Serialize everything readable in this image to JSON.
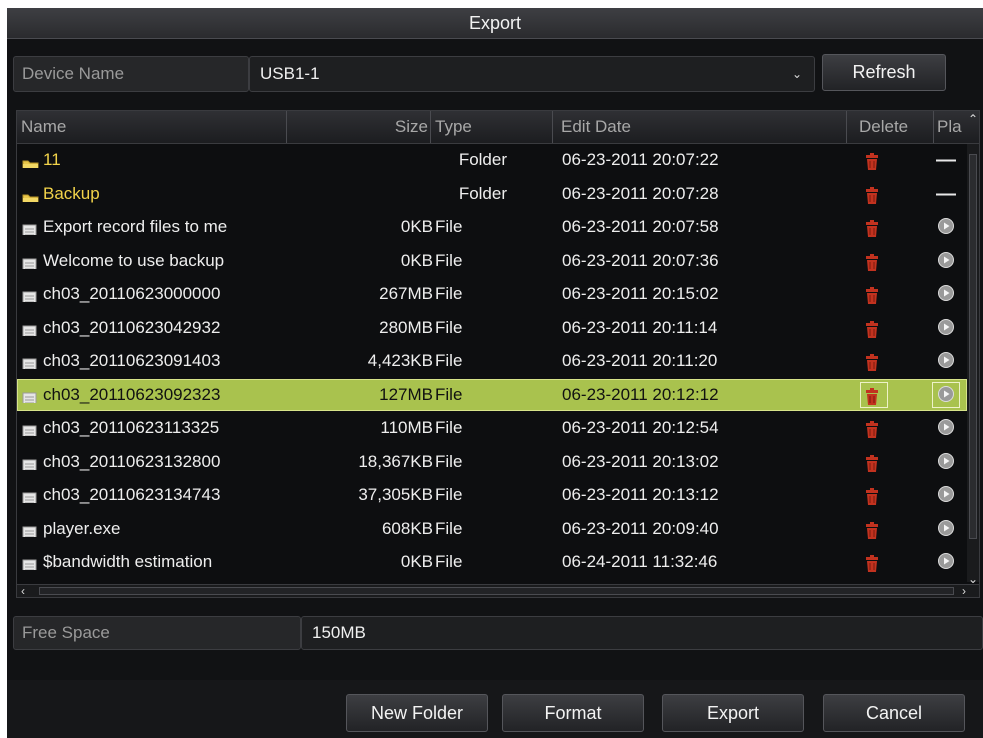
{
  "window": {
    "title": "Export"
  },
  "device": {
    "label": "Device Name",
    "value": "USB1-1",
    "refresh_label": "Refresh"
  },
  "table": {
    "headers": {
      "name": "Name",
      "size": "Size",
      "type": "Type",
      "date": "Edit Date",
      "delete": "Delete",
      "play": "Pla"
    },
    "rows": [
      {
        "name": "11",
        "size": "",
        "type": "Folder",
        "date": "06-23-2011 20:07:22",
        "kind": "folder",
        "play": "—"
      },
      {
        "name": "Backup",
        "size": "",
        "type": "Folder",
        "date": "06-23-2011 20:07:28",
        "kind": "folder",
        "play": "—"
      },
      {
        "name": "Export record files to me",
        "size": "0KB",
        "type": "File",
        "date": "06-23-2011 20:07:58",
        "kind": "file",
        "play": "▶"
      },
      {
        "name": "Welcome to use backup",
        "size": "0KB",
        "type": "File",
        "date": "06-23-2011 20:07:36",
        "kind": "file",
        "play": "▶"
      },
      {
        "name": "ch03_20110623000000",
        "size": "267MB",
        "type": "File",
        "date": "06-23-2011 20:15:02",
        "kind": "file",
        "play": "▶"
      },
      {
        "name": "ch03_20110623042932",
        "size": "280MB",
        "type": "File",
        "date": "06-23-2011 20:11:14",
        "kind": "file",
        "play": "▶"
      },
      {
        "name": "ch03_20110623091403",
        "size": "4,423KB",
        "type": "File",
        "date": "06-23-2011 20:11:20",
        "kind": "file",
        "play": "▶"
      },
      {
        "name": "ch03_20110623092323",
        "size": "127MB",
        "type": "File",
        "date": "06-23-2011 20:12:12",
        "kind": "file",
        "play": "▶",
        "selected": true
      },
      {
        "name": "ch03_20110623113325",
        "size": "110MB",
        "type": "File",
        "date": "06-23-2011 20:12:54",
        "kind": "file",
        "play": "▶"
      },
      {
        "name": "ch03_20110623132800",
        "size": "18,367KB",
        "type": "File",
        "date": "06-23-2011 20:13:02",
        "kind": "file",
        "play": "▶"
      },
      {
        "name": "ch03_20110623134743",
        "size": "37,305KB",
        "type": "File",
        "date": "06-23-2011 20:13:12",
        "kind": "file",
        "play": "▶"
      },
      {
        "name": "player.exe",
        "size": "608KB",
        "type": "File",
        "date": "06-23-2011 20:09:40",
        "kind": "file",
        "play": "▶"
      },
      {
        "name": "$bandwidth estimation",
        "size": "0KB",
        "type": "File",
        "date": "06-24-2011 11:32:46",
        "kind": "file",
        "play": "▶"
      }
    ]
  },
  "free_space": {
    "label": "Free Space",
    "value": "150MB"
  },
  "buttons": {
    "new_folder": "New Folder",
    "format": "Format",
    "export": "Export",
    "cancel": "Cancel"
  },
  "icons": {
    "folder": "folder-icon",
    "file": "file-icon",
    "delete": "trash-icon",
    "play": "play-icon",
    "dropdown": "chevron-down-icon"
  },
  "colors": {
    "selected_row": "#a9c24e",
    "folder_text": "#f2d34a",
    "delete_icon": "#c2321f"
  }
}
